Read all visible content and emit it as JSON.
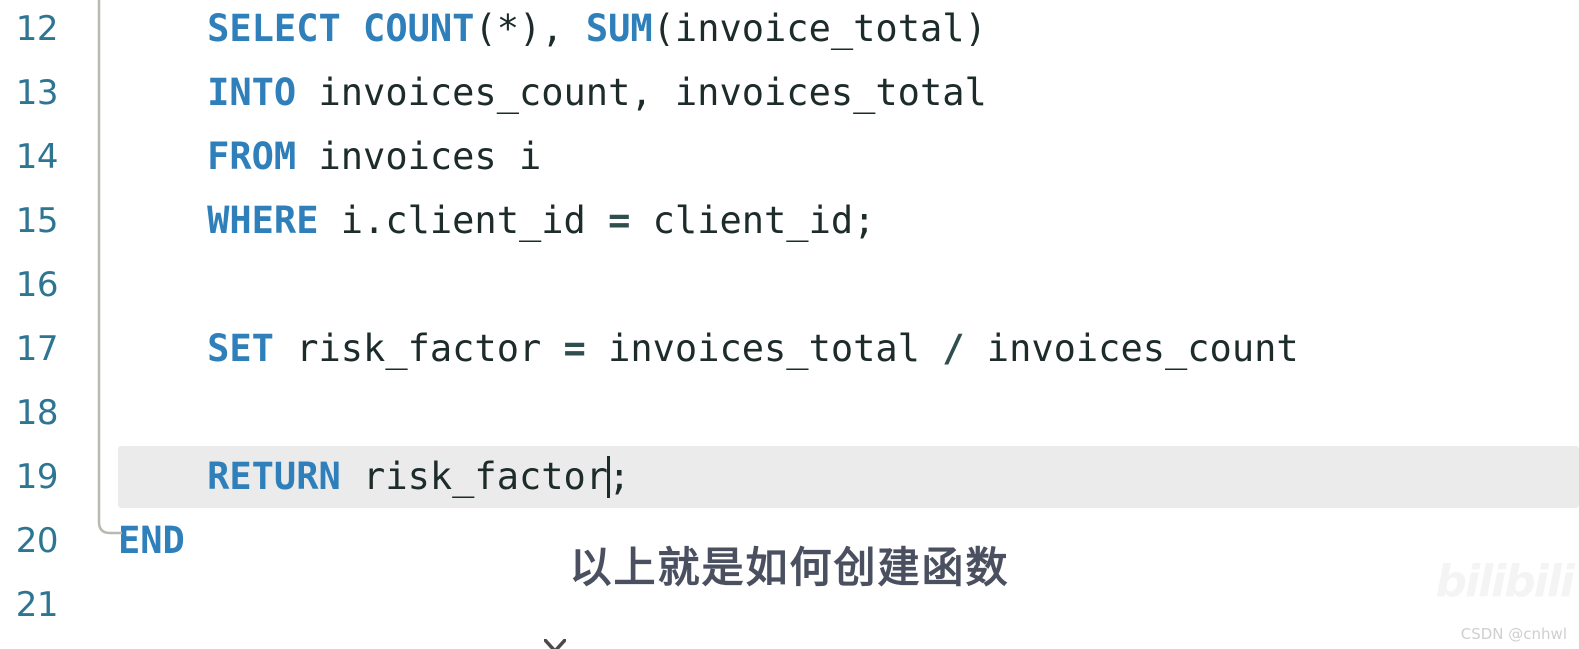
{
  "editor": {
    "language": "sql",
    "theme_background": "#ffffff",
    "gutter_color": "#2e7593",
    "keyword_color": "#2e7fba",
    "text_color": "#1d2b2b",
    "operator_color": "#2f4f4f",
    "current_line_highlight_color": "#ebebeb",
    "current_line": "19",
    "caret_after": "risk_factor",
    "line_numbers": [
      "12",
      "13",
      "14",
      "15",
      "16",
      "17",
      "18",
      "19",
      "20",
      "21"
    ],
    "lines": [
      {
        "number": "12",
        "text": "    SELECT COUNT(*), SUM(invoice_total)",
        "tokens": [
          {
            "t": "    ",
            "k": "plain"
          },
          {
            "t": "SELECT",
            "k": "keyword"
          },
          {
            "t": " ",
            "k": "plain"
          },
          {
            "t": "COUNT",
            "k": "keyword"
          },
          {
            "t": "(*), ",
            "k": "plain"
          },
          {
            "t": "SUM",
            "k": "keyword"
          },
          {
            "t": "(invoice_total)",
            "k": "plain"
          }
        ]
      },
      {
        "number": "13",
        "text": "    INTO invoices_count, invoices_total",
        "tokens": [
          {
            "t": "    ",
            "k": "plain"
          },
          {
            "t": "INTO",
            "k": "keyword"
          },
          {
            "t": " invoices_count, invoices_total",
            "k": "plain"
          }
        ]
      },
      {
        "number": "14",
        "text": "    FROM invoices i",
        "tokens": [
          {
            "t": "    ",
            "k": "plain"
          },
          {
            "t": "FROM",
            "k": "keyword"
          },
          {
            "t": " invoices i",
            "k": "plain"
          }
        ]
      },
      {
        "number": "15",
        "text": "    WHERE i.client_id = client_id;",
        "tokens": [
          {
            "t": "    ",
            "k": "plain"
          },
          {
            "t": "WHERE",
            "k": "keyword"
          },
          {
            "t": " i.client_id ",
            "k": "plain"
          },
          {
            "t": "=",
            "k": "operator"
          },
          {
            "t": " client_id;",
            "k": "plain"
          }
        ]
      },
      {
        "number": "16",
        "text": "",
        "tokens": []
      },
      {
        "number": "17",
        "text": "    SET risk_factor = invoices_total / invoices_count",
        "tokens": [
          {
            "t": "    ",
            "k": "plain"
          },
          {
            "t": "SET",
            "k": "keyword"
          },
          {
            "t": " risk_factor ",
            "k": "plain"
          },
          {
            "t": "=",
            "k": "operator"
          },
          {
            "t": " invoices_total ",
            "k": "plain"
          },
          {
            "t": "/",
            "k": "operator"
          },
          {
            "t": " invoices_count",
            "k": "plain"
          }
        ]
      },
      {
        "number": "18",
        "text": "",
        "tokens": []
      },
      {
        "number": "19",
        "text": "    RETURN risk_factor;",
        "tokens": [
          {
            "t": "    ",
            "k": "plain"
          },
          {
            "t": "RETURN",
            "k": "keyword"
          },
          {
            "t": " risk_factor",
            "k": "plain"
          },
          {
            "t": "CARET",
            "k": "caret"
          },
          {
            "t": ";",
            "k": "plain"
          }
        ]
      },
      {
        "number": "20",
        "text": "END",
        "tokens": [
          {
            "t": "END",
            "k": "keyword"
          }
        ]
      },
      {
        "number": "21",
        "text": "",
        "tokens": []
      }
    ]
  },
  "overlay": {
    "subtitle": "以上就是如何创建函数",
    "subtitle_color": "#4a5060",
    "watermark_bilibili": "bilibili",
    "watermark_csdn": "CSDN @cnhwl"
  }
}
